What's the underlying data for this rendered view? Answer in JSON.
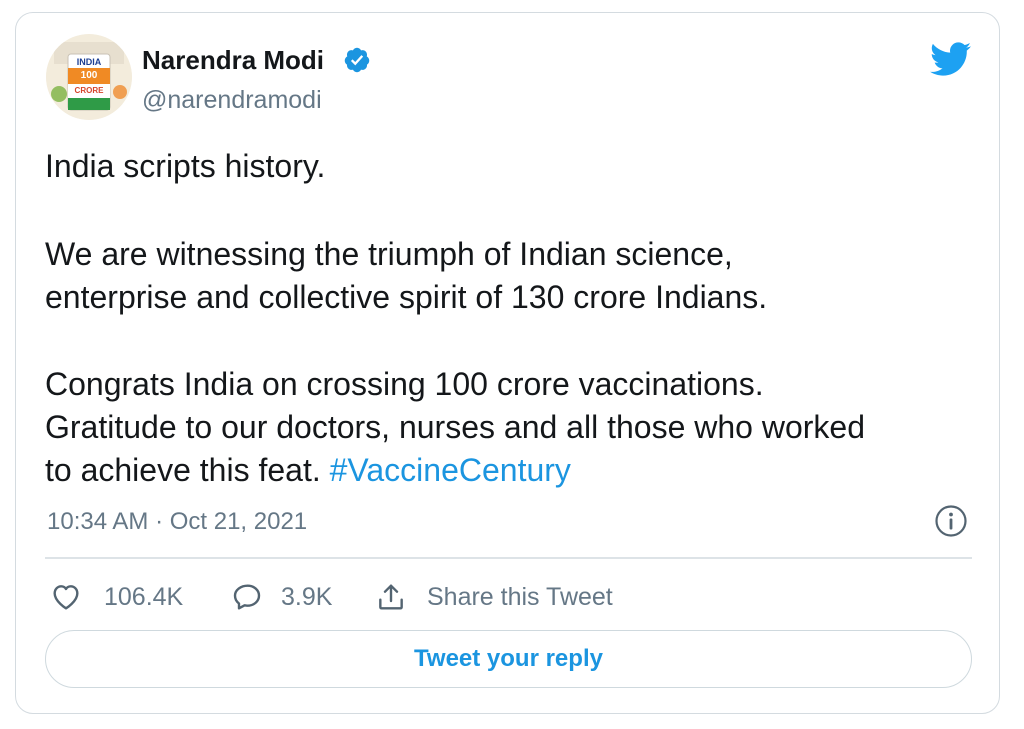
{
  "tweet": {
    "author": {
      "name": "Narendra Modi",
      "handle": "@narendramodi",
      "avatar_text": {
        "country": "INDIA",
        "count": "100",
        "unit": "CRORE"
      }
    },
    "text_lines": [
      "India scripts history.",
      "We are witnessing the triumph of Indian science,",
      "enterprise and collective spirit of 130 crore Indians.",
      "Congrats India on crossing 100 crore vaccinations.",
      "Gratitude to our doctors, nurses and all those who worked",
      "to achieve this feat. "
    ],
    "hashtag": "#VaccineCentury",
    "timestamp": "10:34 AM · Oct 21, 2021",
    "actions": {
      "likes": "106.4K",
      "replies": "3.9K",
      "share_label": "Share this Tweet"
    },
    "reply_button_label": "Tweet your reply"
  },
  "colors": {
    "accent": "#1b95e0",
    "text": "#14171a",
    "secondary_text": "#657786",
    "border": "#d4dbe0"
  },
  "icons": {
    "verified": "verified-badge-icon",
    "brand": "twitter-bird-icon",
    "info": "info-icon",
    "like": "heart-icon",
    "reply": "speech-bubble-icon",
    "share": "share-upload-icon"
  }
}
